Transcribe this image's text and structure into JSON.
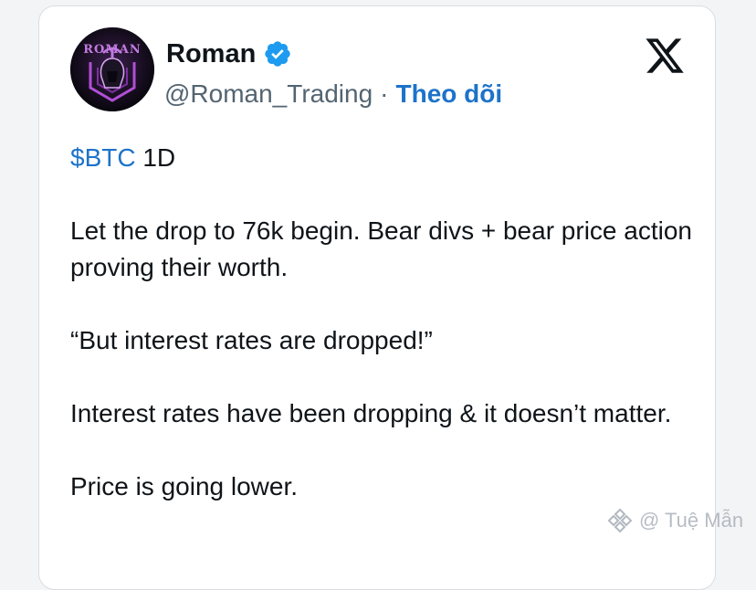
{
  "tweet": {
    "author": {
      "name": "Roman",
      "handle": "@Roman_Trading",
      "separator": "·",
      "follow_label": "Theo dõi",
      "avatar_text": "ROMAN"
    },
    "cashtag": "$BTC",
    "timeframe": "1D",
    "paragraphs": [
      "Let the drop to 76k begin. Bear divs + bear price action proving their worth.",
      "“But interest rates are dropped!”",
      "Interest rates have been dropping & it doesn’t matter.",
      "Price is going lower."
    ]
  },
  "watermark": {
    "text": "@ Tuệ Mẫn"
  },
  "icons": {
    "verified": "verified-badge-icon",
    "platform": "x-logo-icon",
    "watermark": "binance-logo-icon"
  },
  "colors": {
    "link": "#1d73c9",
    "text": "#0f1419",
    "muted": "#536471",
    "verified": "#1d9bf0",
    "avatar_accent": "#b14fd6"
  }
}
